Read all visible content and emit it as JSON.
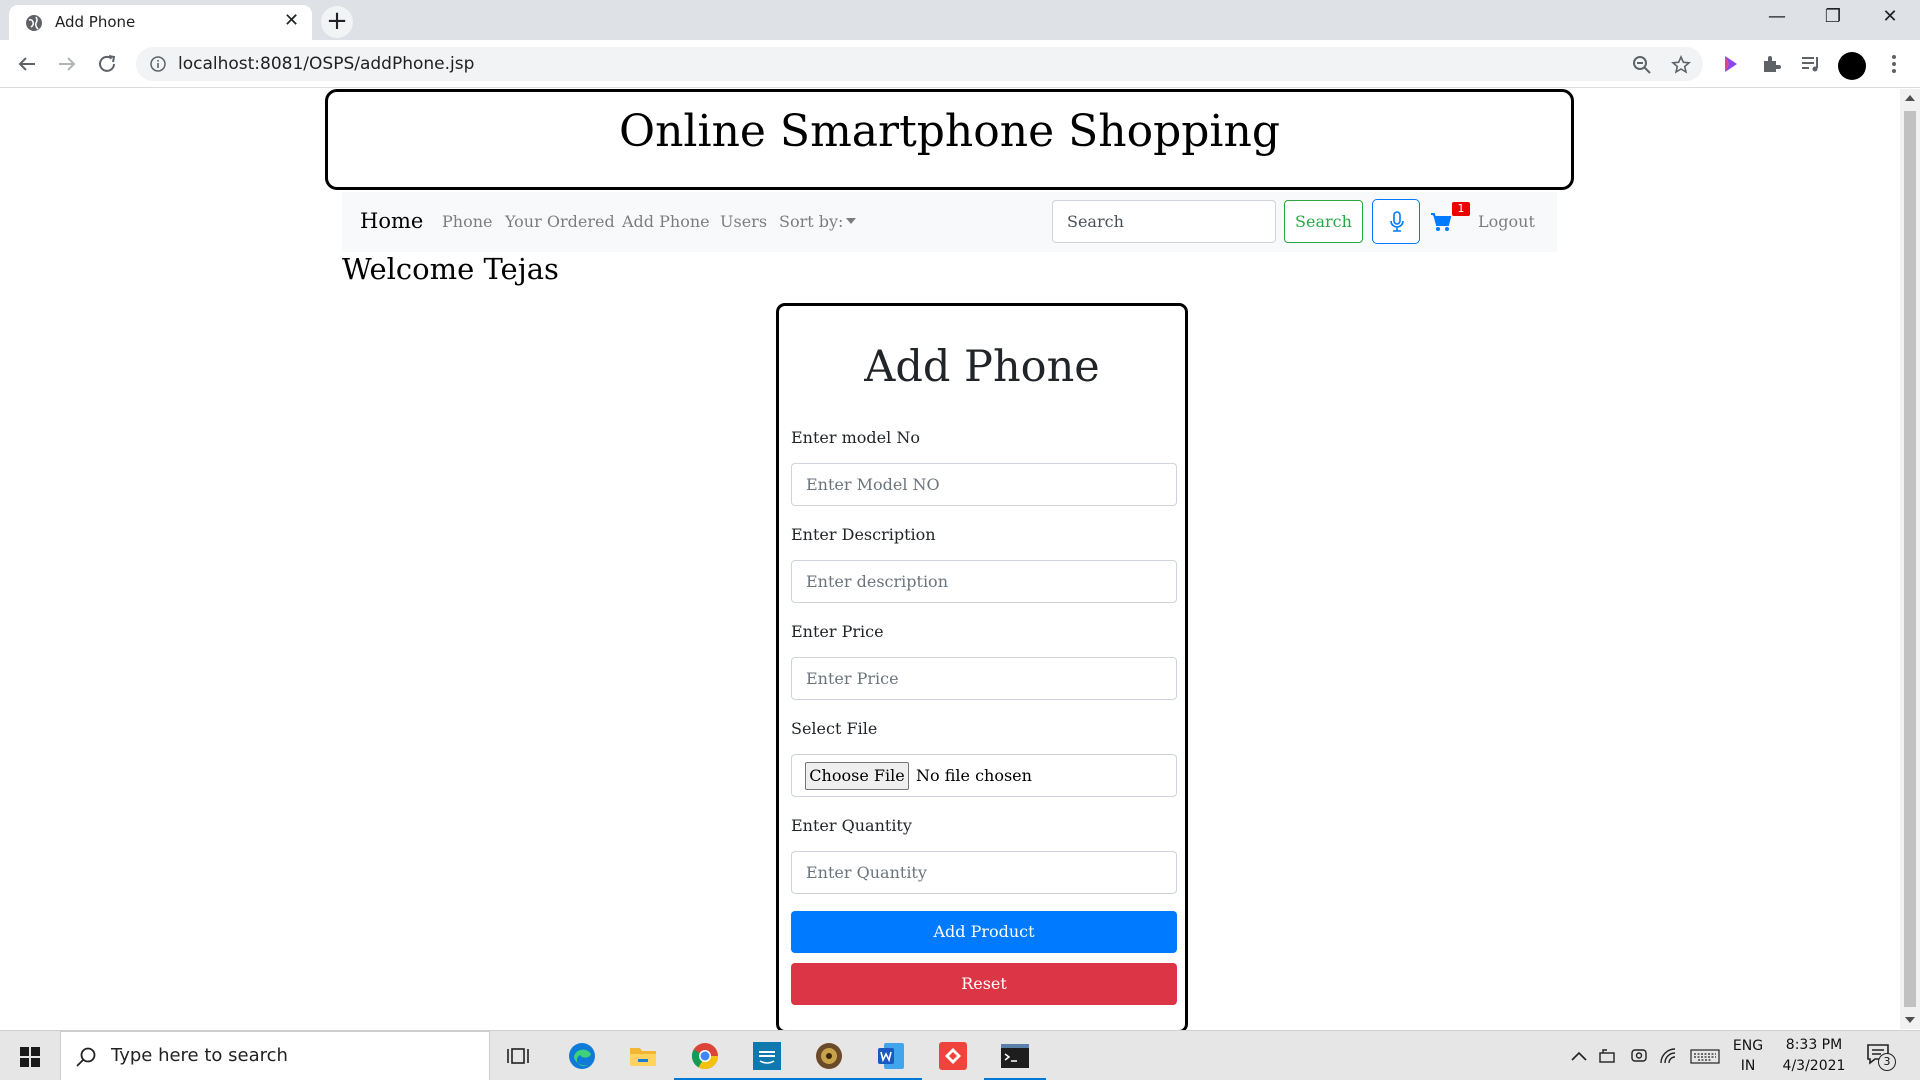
{
  "browser": {
    "tab_title": "Add Phone",
    "tab_close": "✕",
    "new_tab": "+",
    "url": "localhost:8081/OSPS/addPhone.jsp",
    "window_controls": {
      "minimize": "—",
      "maximize": "❐",
      "close": "✕"
    }
  },
  "site": {
    "title": "Online Smartphone Shopping"
  },
  "navbar": {
    "brand": "Home",
    "links": [
      "Phone",
      "Your Ordered",
      "Add Phone",
      "Users"
    ],
    "sort_label": "Sort by:",
    "search_placeholder": "Search",
    "search_button": "Search",
    "cart_count": "1",
    "logout": "Logout"
  },
  "welcome": "Welcome Tejas",
  "form": {
    "title": "Add Phone",
    "model_label": "Enter model No",
    "model_placeholder": "Enter Model NO",
    "desc_label": "Enter Description",
    "desc_placeholder": "Enter description",
    "price_label": "Enter Price",
    "price_placeholder": "Enter Price",
    "file_label": "Select File",
    "file_button": "Choose File",
    "file_status": "No file chosen",
    "qty_label": "Enter Quantity",
    "qty_placeholder": "Enter Quantity",
    "submit": "Add Product",
    "reset": "Reset"
  },
  "taskbar": {
    "search_placeholder": "Type here to search",
    "lang_top": "ENG",
    "lang_bottom": "IN",
    "time": "8:33 PM",
    "date": "4/3/2021",
    "notifications": "3"
  },
  "colors": {
    "primary": "#007bff",
    "danger": "#dc3545",
    "success": "#28a745",
    "badge": "#e00000"
  }
}
